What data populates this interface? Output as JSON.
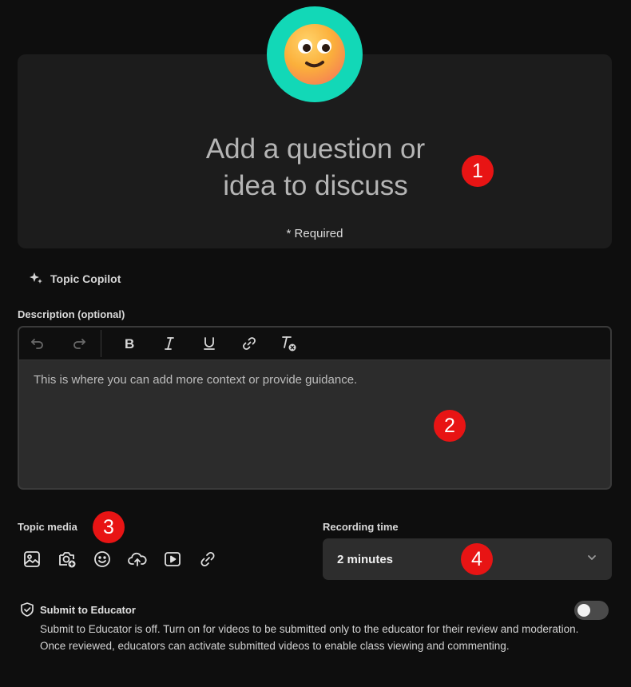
{
  "question": {
    "line1": "Add a question or",
    "line2": "idea to discuss",
    "required": "* Required",
    "avatar_icon": "smiling-emoji-icon"
  },
  "copilot": {
    "label": "Topic Copilot",
    "icon": "sparkle-icon"
  },
  "description": {
    "label": "Description (optional)",
    "placeholder": "This is where you can add more context or provide guidance.",
    "toolbar": [
      "undo-icon",
      "redo-icon",
      "bold-icon",
      "italic-icon",
      "underline-icon",
      "link-icon",
      "clear-format-icon"
    ]
  },
  "topic_media": {
    "label": "Topic media",
    "buttons": [
      "image-icon",
      "camera-add-icon",
      "emoji-icon",
      "upload-cloud-icon",
      "video-play-icon",
      "link-icon"
    ]
  },
  "recording_time": {
    "label": "Recording time",
    "value": "2 minutes"
  },
  "submit_to_educator": {
    "title": "Submit to Educator",
    "description": "Submit to Educator is off. Turn on for videos to be submitted only to the educator for their review and moderation. Once reviewed, educators can activate submitted videos to enable class viewing and commenting.",
    "enabled": false
  },
  "annotations": [
    "1",
    "2",
    "3",
    "4"
  ],
  "colors": {
    "background": "#0e0e0e",
    "card": "#1c1c1c",
    "avatar_bg": "#12d8b7",
    "badge": "#e81414"
  }
}
